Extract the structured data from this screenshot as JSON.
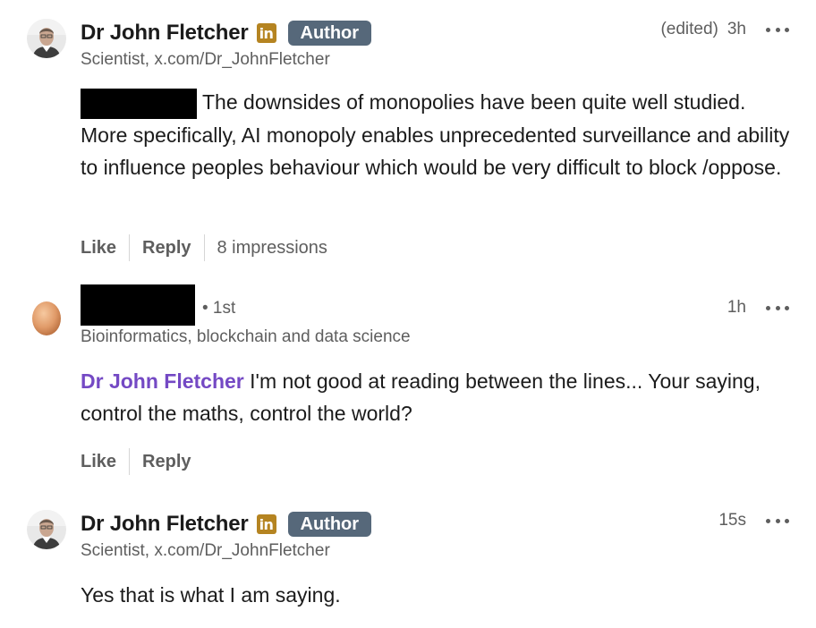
{
  "comments": [
    {
      "author": "Dr John Fletcher",
      "linkedin_badge": "in",
      "badge": "Author",
      "subtitle": "Scientist, x.com/Dr_JohnFletcher",
      "edited": "(edited)",
      "time": "3h",
      "text": "The downsides of monopolies have been quite well studied.  More specifically, AI monopoly enables unprecedented surveillance and ability to influence peoples behaviour which would be very difficult to block /oppose.",
      "actions": {
        "like": "Like",
        "reply": "Reply",
        "impressions": "8 impressions"
      }
    },
    {
      "degree": "• 1st",
      "subtitle": "Bioinformatics, blockchain and data science",
      "time": "1h",
      "mention": "Dr John Fletcher",
      "text": "I'm not good at reading between the lines... Your saying, control the maths, control the world?",
      "actions": {
        "like": "Like",
        "reply": "Reply"
      }
    },
    {
      "author": "Dr John Fletcher",
      "linkedin_badge": "in",
      "badge": "Author",
      "subtitle": "Scientist, x.com/Dr_JohnFletcher",
      "time": "15s",
      "text": "Yes that is what I am saying."
    }
  ],
  "icons": {
    "more": "more-horizontal-icon",
    "linkedin": "linkedin-icon"
  },
  "colors": {
    "mention": "#7449c4",
    "author_badge": "#56687a",
    "linkedin_badge": "#b58421",
    "secondary_text": "#5e5e5e"
  }
}
